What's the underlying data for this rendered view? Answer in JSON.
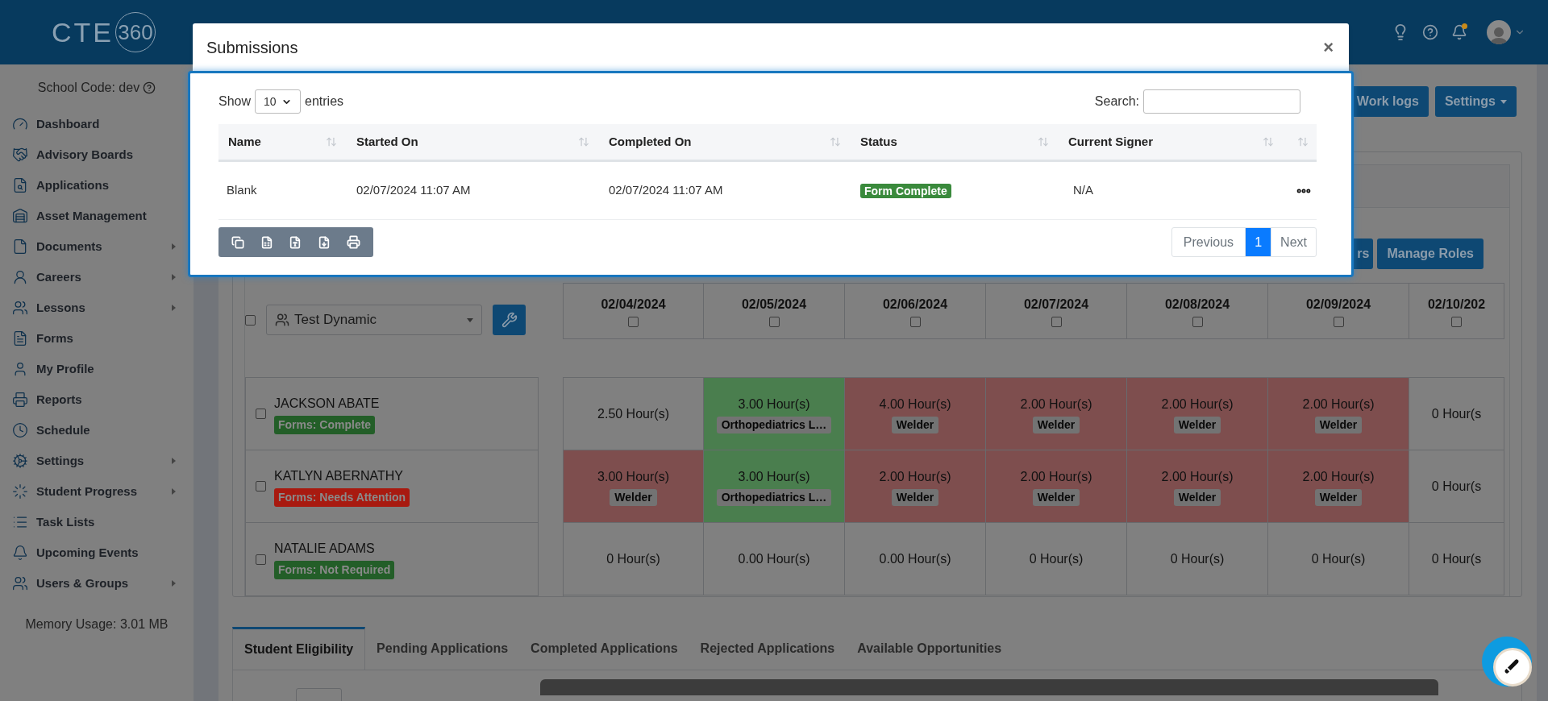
{
  "header": {
    "logo_text": "CTE",
    "logo_number": "360",
    "unread_notifications": true
  },
  "sidebar": {
    "school_code": "School Code: dev",
    "items": [
      {
        "label": "Dashboard",
        "expandable": false
      },
      {
        "label": "Advisory Boards",
        "expandable": false
      },
      {
        "label": "Applications",
        "expandable": false
      },
      {
        "label": "Asset Management",
        "expandable": false
      },
      {
        "label": "Documents",
        "expandable": true
      },
      {
        "label": "Careers",
        "expandable": true
      },
      {
        "label": "Lessons",
        "expandable": true
      },
      {
        "label": "Forms",
        "expandable": false
      },
      {
        "label": "My Profile",
        "expandable": false
      },
      {
        "label": "Reports",
        "expandable": false
      },
      {
        "label": "Schedule",
        "expandable": false
      },
      {
        "label": "Settings",
        "expandable": true
      },
      {
        "label": "Student Progress",
        "expandable": true
      },
      {
        "label": "Task Lists",
        "expandable": false
      },
      {
        "label": "Upcoming Events",
        "expandable": false
      },
      {
        "label": "Users & Groups",
        "expandable": true
      }
    ],
    "memory_usage": "Memory Usage: 3.01 MB"
  },
  "toolbar": {
    "buttons": [
      {
        "label": "Work logs",
        "dropdown": false
      },
      {
        "label": "Settings",
        "dropdown": true
      }
    ]
  },
  "schedule": {
    "buttons": [
      "rs",
      "Manage Roles"
    ],
    "group_select": {
      "value": "Test Dynamic",
      "checked": false
    },
    "dates": [
      {
        "label": "02/04/2024",
        "checked": false
      },
      {
        "label": "02/05/2024",
        "checked": false
      },
      {
        "label": "02/06/2024",
        "checked": false
      },
      {
        "label": "02/07/2024",
        "checked": false
      },
      {
        "label": "02/08/2024",
        "checked": false
      },
      {
        "label": "02/09/2024",
        "checked": false
      },
      {
        "label": "02/10/202",
        "checked": false
      }
    ],
    "students": [
      {
        "name": "JACKSON ABATE",
        "checked": false,
        "forms": {
          "label": "Forms: Complete",
          "color": "#235e28"
        },
        "cells": [
          {
            "hours": "2.50 Hour(s)"
          },
          {
            "hours": "3.00 Hour(s)",
            "tag": "Orthopediatrics L…",
            "color": "#4a7e4e"
          },
          {
            "hours": "4.00 Hour(s)",
            "tag": "Welder",
            "color": "#7e4e4e"
          },
          {
            "hours": "2.00 Hour(s)",
            "tag": "Welder",
            "color": "#7e4e4e"
          },
          {
            "hours": "2.00 Hour(s)",
            "tag": "Welder",
            "color": "#7e4e4e"
          },
          {
            "hours": "2.00 Hour(s)",
            "tag": "Welder",
            "color": "#7e4e4e"
          },
          {
            "hours": "0 Hour(s"
          }
        ]
      },
      {
        "name": "KATLYN ABERNATHY",
        "checked": false,
        "forms": {
          "label": "Forms: Needs Attention",
          "color": "#a81a10"
        },
        "cells": [
          {
            "hours": "3.00 Hour(s)",
            "tag": "Welder",
            "color": "#7e4e4e"
          },
          {
            "hours": "3.00 Hour(s)",
            "tag": "Orthopediatrics L…",
            "color": "#4a7e4e"
          },
          {
            "hours": "2.00 Hour(s)",
            "tag": "Welder",
            "color": "#7e4e4e"
          },
          {
            "hours": "2.00 Hour(s)",
            "tag": "Welder",
            "color": "#7e4e4e"
          },
          {
            "hours": "2.00 Hour(s)",
            "tag": "Welder",
            "color": "#7e4e4e"
          },
          {
            "hours": "2.00 Hour(s)",
            "tag": "Welder",
            "color": "#7e4e4e"
          },
          {
            "hours": "0 Hour(s"
          }
        ]
      },
      {
        "name": "NATALIE ADAMS",
        "checked": false,
        "forms": {
          "label": "Forms: Not Required",
          "color": "#235e28"
        },
        "cells": [
          {
            "hours": "0 Hour(s)"
          },
          {
            "hours": "0.00 Hour(s)"
          },
          {
            "hours": "0.00 Hour(s)"
          },
          {
            "hours": "0 Hour(s)"
          },
          {
            "hours": "0 Hour(s)"
          },
          {
            "hours": "0 Hour(s)"
          },
          {
            "hours": "0 Hour(s"
          }
        ]
      }
    ]
  },
  "bottom_tabs": [
    {
      "label": "Student Eligibility",
      "selected": true
    },
    {
      "label": "Pending Applications",
      "selected": false
    },
    {
      "label": "Completed Applications",
      "selected": false
    },
    {
      "label": "Rejected Applications",
      "selected": false
    },
    {
      "label": "Available Opportunities",
      "selected": false
    }
  ],
  "modal": {
    "title": "Submissions",
    "close": "×",
    "show_label": "Show",
    "page_size": "10",
    "entries_label": "entries",
    "search_label": "Search:",
    "columns": [
      {
        "label": "Name"
      },
      {
        "label": "Started On"
      },
      {
        "label": "Completed On"
      },
      {
        "label": "Status"
      },
      {
        "label": "Current Signer"
      },
      {}
    ],
    "rows": [
      {
        "name": "Blank",
        "started_on": "02/07/2024 11:07 AM",
        "completed_on": "02/07/2024 11:07 AM",
        "status": {
          "label": "Form Complete",
          "color": "#3a8a3c"
        },
        "current_signer": "N/A"
      }
    ],
    "pagination": {
      "previous": "Previous",
      "pages": [
        {
          "label": "1",
          "selected": true
        }
      ],
      "next": "Next"
    }
  }
}
